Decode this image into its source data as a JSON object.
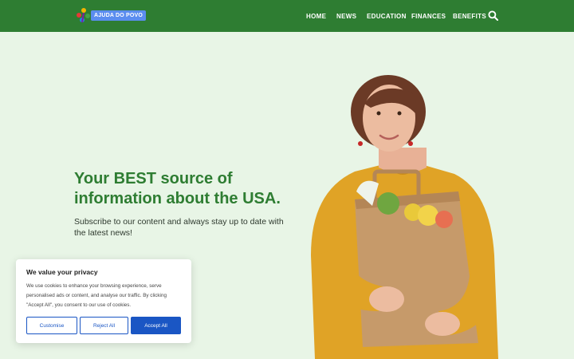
{
  "brand": {
    "name": "AJUDA DO POVO"
  },
  "nav": {
    "items": [
      "HOME",
      "NEWS",
      "EDUCATION",
      "FINANCES",
      "BENEFITS"
    ],
    "search_icon": "search-icon"
  },
  "hero": {
    "title_line1": "Your BEST source of",
    "title_bold": "information",
    "title_rest": " about the USA.",
    "subtitle": "Subscribe to our content and always stay up to date with the latest news!"
  },
  "cookie": {
    "title": "We value your privacy",
    "text": "We use cookies to enhance your browsing experience, serve personalised ads or content, and analyse our traffic. By clicking \"Accept All\", you consent to our use of cookies.",
    "customise_label": "Customise",
    "reject_label": "Reject All",
    "accept_label": "Accept All"
  },
  "colors": {
    "header": "#2e7d32",
    "background": "#e8f5e6",
    "accent_blue": "#1a56c4"
  }
}
